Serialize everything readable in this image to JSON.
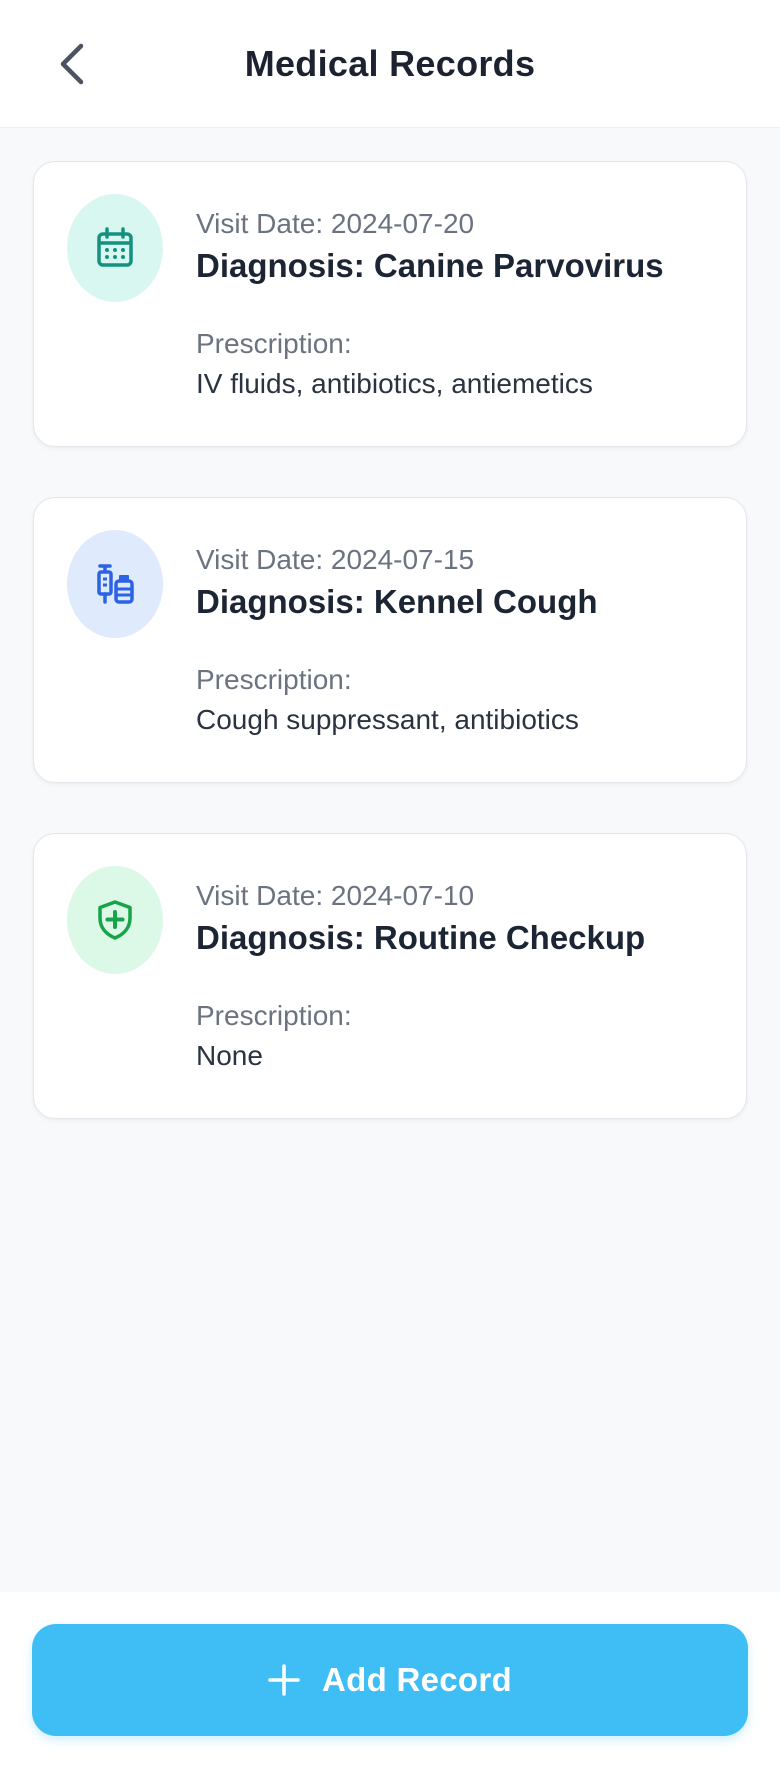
{
  "header": {
    "title": "Medical Records",
    "back_icon": "chevron-left-icon"
  },
  "records": [
    {
      "icon": "calendar-icon",
      "icon_color": "#14917f",
      "icon_bg": "#d8f7f1",
      "visit_date": "Visit Date: 2024-07-20",
      "diagnosis": "Diagnosis: Canine Parvovirus",
      "prescription_label": "Prescription:",
      "prescription": "IV fluids, antibiotics, antiemetics"
    },
    {
      "icon": "syringe-vial-icon",
      "icon_color": "#2b63e3",
      "icon_bg": "#dfeafd",
      "visit_date": "Visit Date: 2024-07-15",
      "diagnosis": "Diagnosis: Kennel Cough",
      "prescription_label": "Prescription:",
      "prescription": "Cough suppressant, antibiotics"
    },
    {
      "icon": "shield-plus-icon",
      "icon_color": "#17a34a",
      "icon_bg": "#dcf8e6",
      "visit_date": "Visit Date: 2024-07-10",
      "diagnosis": "Diagnosis: Routine Checkup",
      "prescription_label": "Prescription:",
      "prescription": "None"
    }
  ],
  "footer": {
    "add_button_label": "Add Record",
    "add_icon": "plus-icon",
    "button_color": "#3ebef5"
  }
}
